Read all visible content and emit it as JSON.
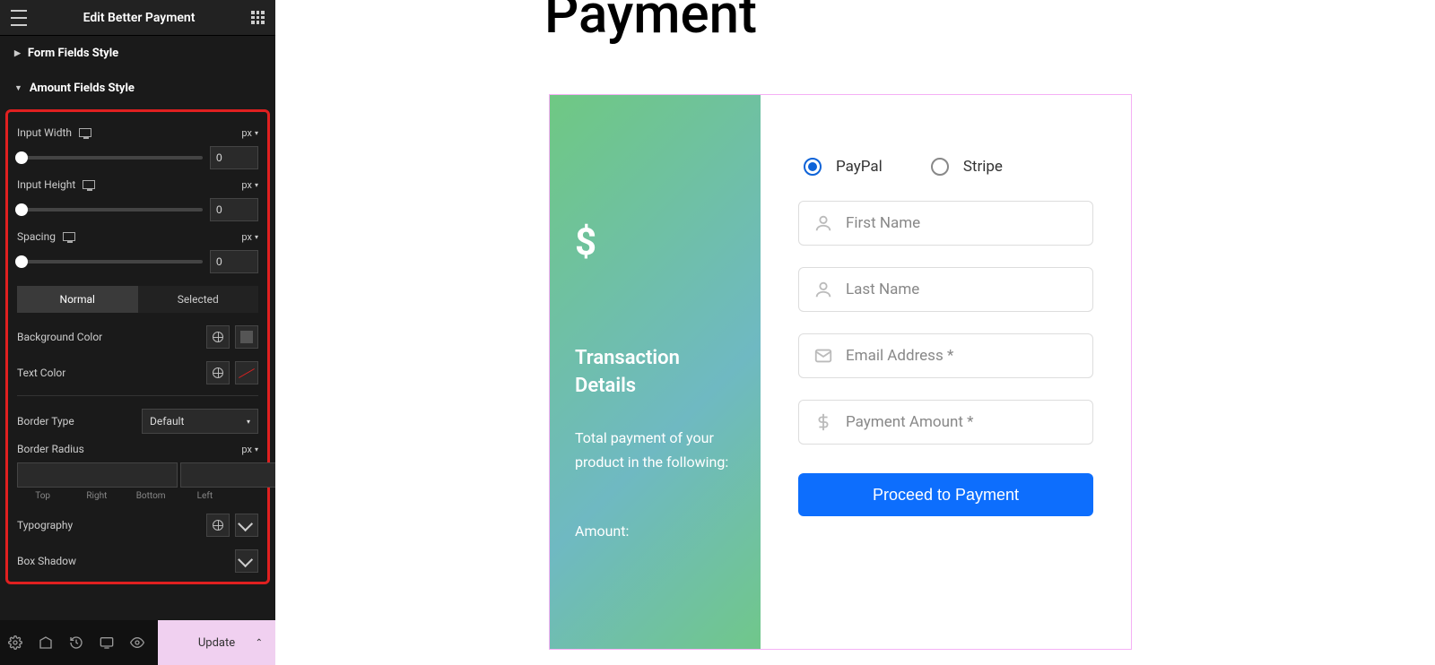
{
  "sidebar": {
    "title": "Edit Better Payment",
    "section_form_fields": "Form Fields Style",
    "section_amount_fields": "Amount Fields Style",
    "input_width_label": "Input Width",
    "input_width_unit": "px",
    "input_width_value": "0",
    "input_height_label": "Input Height",
    "input_height_unit": "px",
    "input_height_value": "0",
    "spacing_label": "Spacing",
    "spacing_unit": "px",
    "spacing_value": "0",
    "tab_normal": "Normal",
    "tab_selected": "Selected",
    "bg_color_label": "Background Color",
    "text_color_label": "Text Color",
    "border_type_label": "Border Type",
    "border_type_value": "Default",
    "border_radius_label": "Border Radius",
    "border_radius_unit": "px",
    "dim_top": "Top",
    "dim_right": "Right",
    "dim_bottom": "Bottom",
    "dim_left": "Left",
    "typography_label": "Typography",
    "box_shadow_label": "Box Shadow",
    "update_label": "Update"
  },
  "page": {
    "title": "Payment",
    "transaction_label": "Transaction Details",
    "transaction_text": "Total payment of your product in the following:",
    "amount_label": "Amount:",
    "radio_paypal": "PayPal",
    "radio_stripe": "Stripe",
    "field_first_name": "First Name",
    "field_last_name": "Last Name",
    "field_email": "Email Address *",
    "field_amount": "Payment Amount *",
    "proceed_label": "Proceed to Payment"
  }
}
